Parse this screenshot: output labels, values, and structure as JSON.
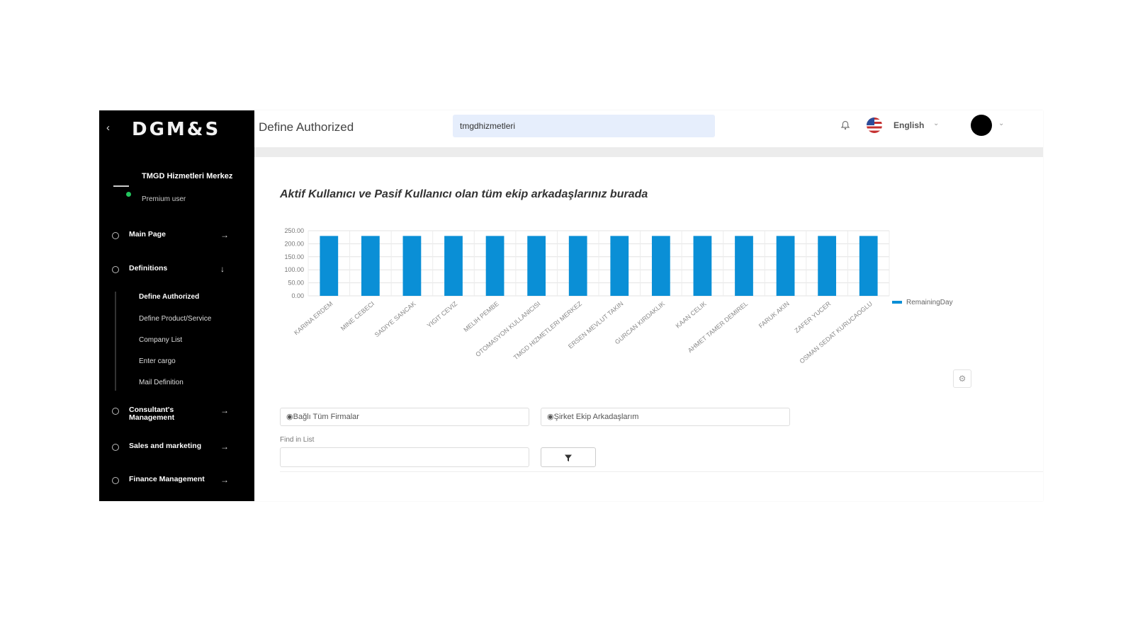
{
  "sidebar": {
    "logo": "DGM&S",
    "user": {
      "name": "TMGD Hizmetleri Merkez",
      "role": "Premium user"
    },
    "nav": [
      {
        "label": "Main Page"
      },
      {
        "label": "Definitions"
      },
      {
        "label": "Consultant's Management"
      },
      {
        "label": "Sales and marketing"
      },
      {
        "label": "Finance Management"
      }
    ],
    "definitions_sub": [
      {
        "label": "Define Authorized"
      },
      {
        "label": "Define Product/Service"
      },
      {
        "label": "Company List"
      },
      {
        "label": "Enter cargo"
      },
      {
        "label": "Mail Definition"
      }
    ]
  },
  "header": {
    "title": "Define Authorized",
    "search_value": "tmgdhizmetleri",
    "language": "English"
  },
  "main": {
    "headline": "Aktif Kullanıcı ve Pasif Kullanıcı olan tüm ekip arkadaşlarınız burada",
    "filter_companies": "Bağlı Tüm Firmalar",
    "filter_team": "Şirket Ekip Arkadaşlarım",
    "find_label": "Find in List",
    "filter_button_icon": "filter-icon"
  },
  "colors": {
    "bar": "#0a8fd6",
    "sidebar": "#000000",
    "search_bg": "#e6eefc"
  },
  "chart_data": {
    "type": "bar",
    "categories": [
      "KARINA ERDEM",
      "MINE CEBECI",
      "SADIYE SANCAK",
      "YIGIT CEVIZ",
      "MELIH PEMBE",
      "OTOMASYON KULLANICISI",
      "TMGD HIZMETLERI MERKEZ",
      "ERSEN MEVLUT TAKIN",
      "GURCAN KIRDAKLIK",
      "KAAN CELIK",
      "AHMET TAMER DEMIREL",
      "FARUK AKIN",
      "ZAFER YUCER",
      "OSMAN SEDAT KURUCAOGLU"
    ],
    "series": [
      {
        "name": "RemainingDay",
        "values": [
          230,
          230,
          230,
          230,
          230,
          230,
          230,
          230,
          230,
          230,
          230,
          230,
          230,
          230
        ]
      }
    ],
    "yticks": [
      "0.00",
      "50.00",
      "100.00",
      "150.00",
      "200.00",
      "250.00"
    ],
    "ylim": [
      0,
      250
    ],
    "grid": true,
    "legend_position": "right"
  }
}
